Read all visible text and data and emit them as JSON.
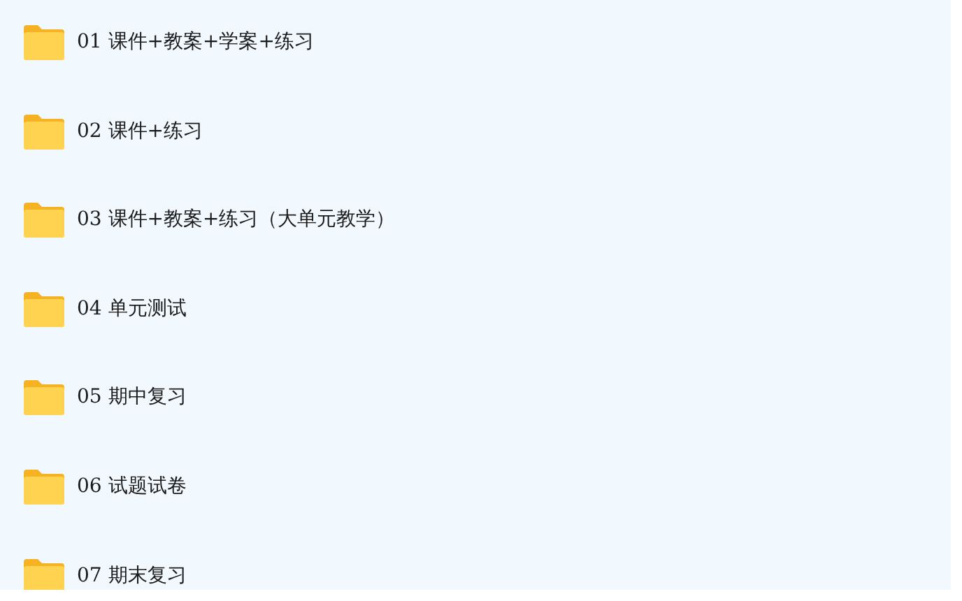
{
  "folders": [
    {
      "name": "01 课件+教案+学案+练习"
    },
    {
      "name": "02 课件+练习"
    },
    {
      "name": "03 课件+教案+练习（大单元教学）"
    },
    {
      "name": "04 单元测试"
    },
    {
      "name": "05 期中复习"
    },
    {
      "name": "06 试题试卷"
    },
    {
      "name": "07 期末复习"
    }
  ]
}
